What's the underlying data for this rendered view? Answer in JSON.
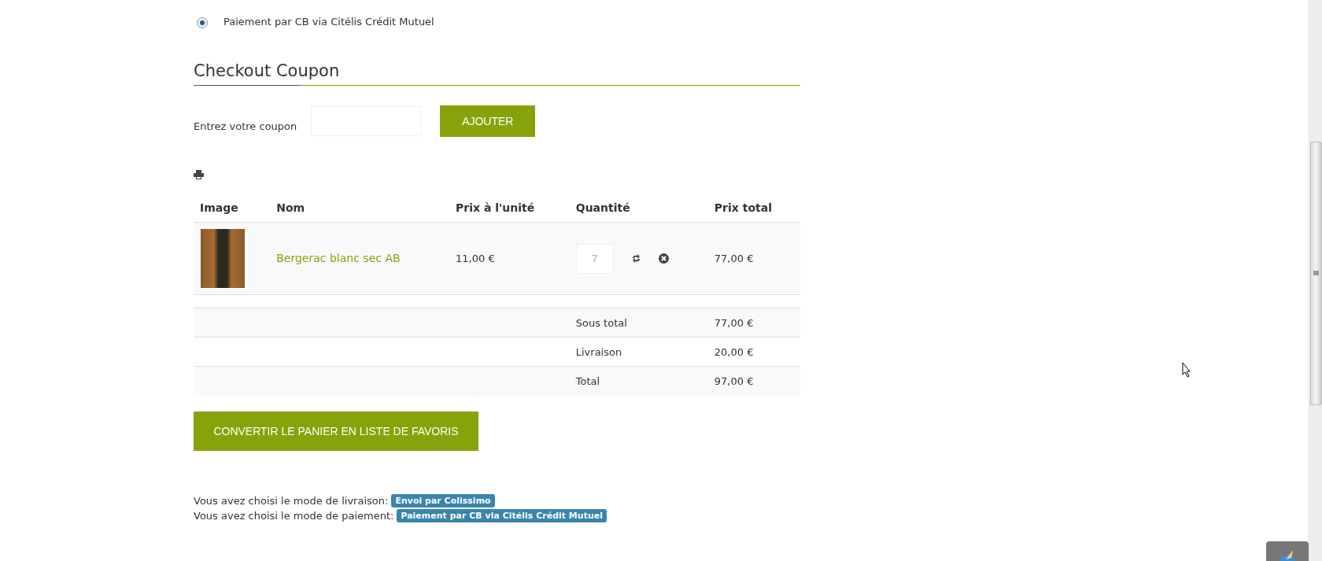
{
  "payment_option": {
    "label": "Paiement par CB via Citélis Crédit Mutuel",
    "selected": true
  },
  "coupon": {
    "title": "Checkout Coupon",
    "label": "Entrez votre coupon",
    "button": "AJOUTER"
  },
  "cart": {
    "columns": [
      "Image",
      "Nom",
      "Prix à l'unité",
      "Quantité",
      "Prix total"
    ],
    "rows": [
      {
        "name": "Bergerac blanc sec AB",
        "unit_price": "11,00 €",
        "quantity": "7",
        "total": "77,00 €"
      }
    ],
    "totals": [
      {
        "label": "Sous total",
        "value": "77,00 €"
      },
      {
        "label": "Livraison",
        "value": "20,00 €"
      },
      {
        "label": "Total",
        "value": "97,00 €"
      }
    ]
  },
  "wishlist_button": "CONVERTIR LE PANIER EN LISTE DE FAVORIS",
  "summary": [
    {
      "text": "Vous avez choisi le mode de livraison:",
      "badge": "Envoi par Colissimo"
    },
    {
      "text": "Vous avez choisi le mode de paiement:",
      "badge": "Paiement par CB via Citélis Crédit Mutuel"
    }
  ]
}
